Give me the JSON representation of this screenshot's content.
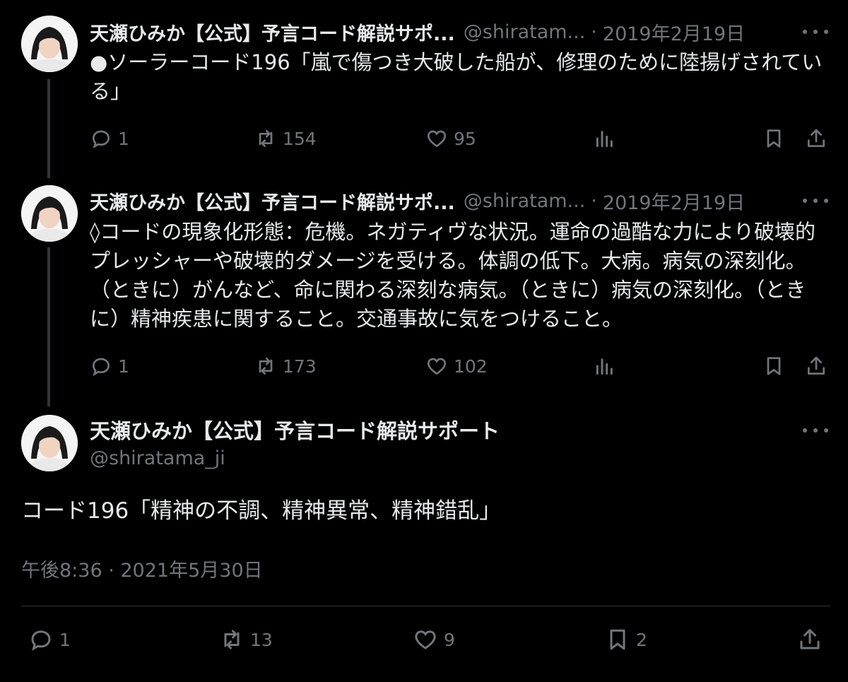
{
  "tweets": [
    {
      "name": "天瀬ひみか【公式】予言コード解説サポ...",
      "handle": "@shiratam...",
      "sep": "·",
      "date": "2019年2月19日",
      "text": "●ソーラーコード196「嵐で傷つき大破した船が、修理のために陸揚げされている」",
      "replies": "1",
      "retweets": "154",
      "likes": "95"
    },
    {
      "name": "天瀬ひみか【公式】予言コード解説サポ...",
      "handle": "@shiratam...",
      "sep": "·",
      "date": "2019年2月19日",
      "text": "◊コードの現象化形態：危機。ネガティヴな状況。運命の過酷な力により破壊的プレッシャーや破壊的ダメージを受ける。体調の低下。大病。病気の深刻化。（ときに）がんなど、命に関わる深刻な病気。（ときに）病気の深刻化。（ときに）精神疾患に関すること。交通事故に気をつけること。",
      "replies": "1",
      "retweets": "173",
      "likes": "102"
    }
  ],
  "main": {
    "name": "天瀬ひみか【公式】予言コード解説サポート",
    "handle": "@shiratama_ji",
    "text": "コード196「精神の不調、精神異常、精神錯乱」",
    "meta": "午後8:36 · 2021年5月30日",
    "replies": "1",
    "retweets": "13",
    "likes": "9",
    "bookmarks": "2"
  },
  "icons": {
    "reply": "reply-icon",
    "retweet": "retweet-icon",
    "like": "heart-icon",
    "views": "analytics-icon",
    "bookmark": "bookmark-icon",
    "share": "share-icon",
    "more": "more-icon",
    "avatar": "avatar"
  }
}
